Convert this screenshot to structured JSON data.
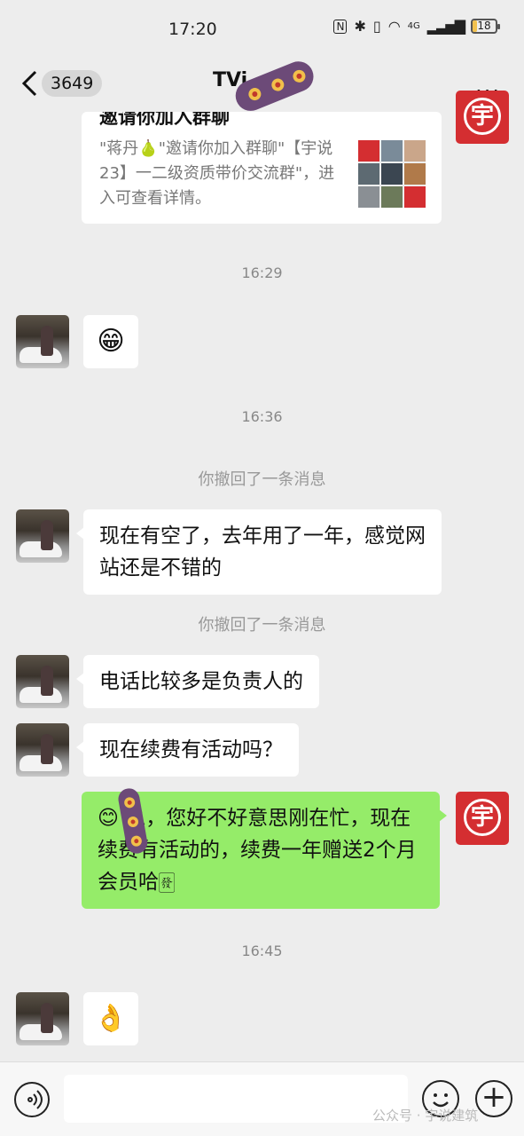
{
  "status_bar": {
    "time": "17:20",
    "nfc": "N",
    "network_label": "4G",
    "battery_level": 18,
    "battery_label": "18"
  },
  "nav": {
    "unread_count": "3649",
    "title": "TVi",
    "more_label": "..."
  },
  "card": {
    "title": "邀请你加入群聊",
    "description": "\"蒋丹🍐\"邀请你加入群聊\"【宇说23】一二级资质带价交流群\"，进入可查看详情。"
  },
  "times": [
    "16:29",
    "16:36",
    "16:45"
  ],
  "system_notes": [
    "你撤回了一条消息",
    "你撤回了一条消息"
  ],
  "messages": [
    {
      "side": "left",
      "type": "emoji",
      "content": "😁"
    },
    {
      "side": "left",
      "type": "text",
      "content": "现在有空了，去年用了一年，感觉网站还是不错的"
    },
    {
      "side": "left",
      "type": "text",
      "content": "电话比较多是负责人的"
    },
    {
      "side": "left",
      "type": "text",
      "content": "现在续费有活动吗？"
    },
    {
      "side": "right",
      "type": "text",
      "content": "😊    总，您好不好意思刚在忙，现在续费有活动的，续费一年赠送2个月会员哈🀅"
    },
    {
      "side": "left",
      "type": "emoji",
      "content": "👌"
    }
  ],
  "logo_char": "宇",
  "input_bar": {
    "placeholder": "",
    "plus_label": "+"
  },
  "watermark": "公众号 · 宇说建筑",
  "colors": {
    "background": "#ededed",
    "bubble_self": "#95ec69",
    "bubble_other": "#ffffff",
    "logo_red": "#d42e31"
  }
}
